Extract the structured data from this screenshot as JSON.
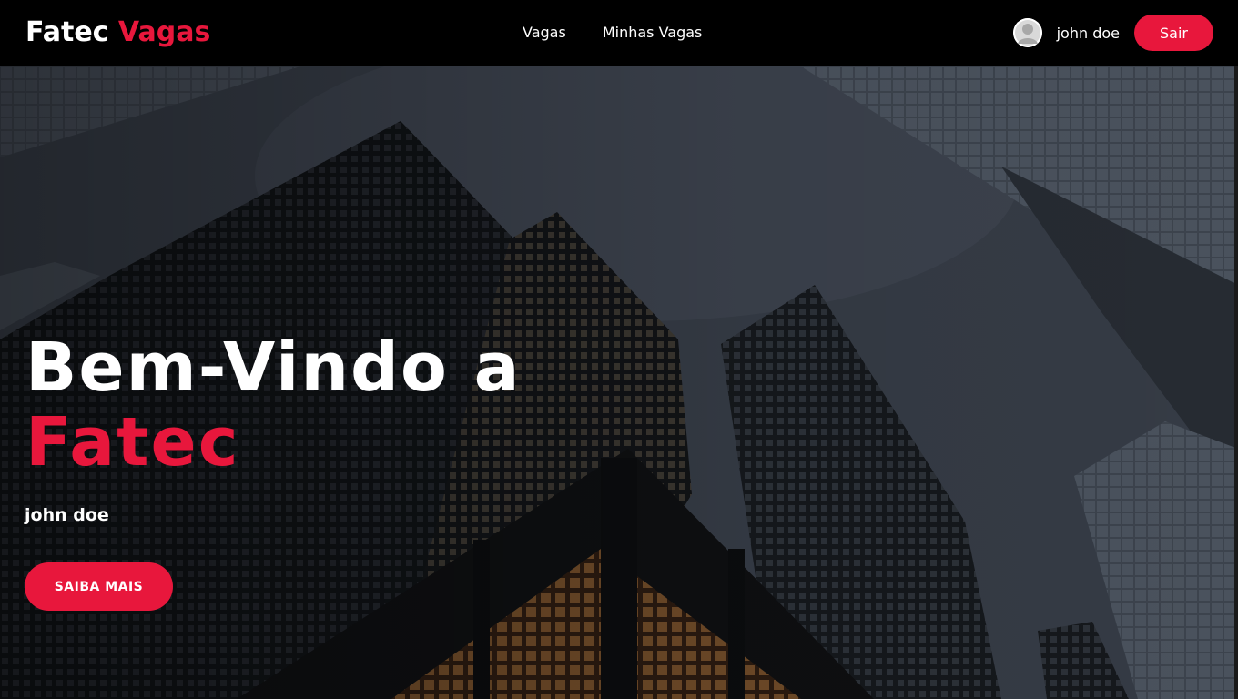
{
  "navbar": {
    "brand_primary": "Fatec",
    "brand_accent": "Vagas",
    "links": [
      {
        "label": "Vagas"
      },
      {
        "label": "Minhas Vagas"
      }
    ],
    "user": {
      "name": "john doe",
      "avatar_icon": "user-avatar-icon"
    },
    "logout_label": "Sair"
  },
  "hero": {
    "title_line1": "Bem-Vindo a",
    "title_line2": "Fatec",
    "subtitle": "john doe",
    "cta_label": "SAIBA MAIS"
  },
  "colors": {
    "accent": "#e8173c",
    "navbar_bg": "#000000",
    "text": "#ffffff"
  }
}
